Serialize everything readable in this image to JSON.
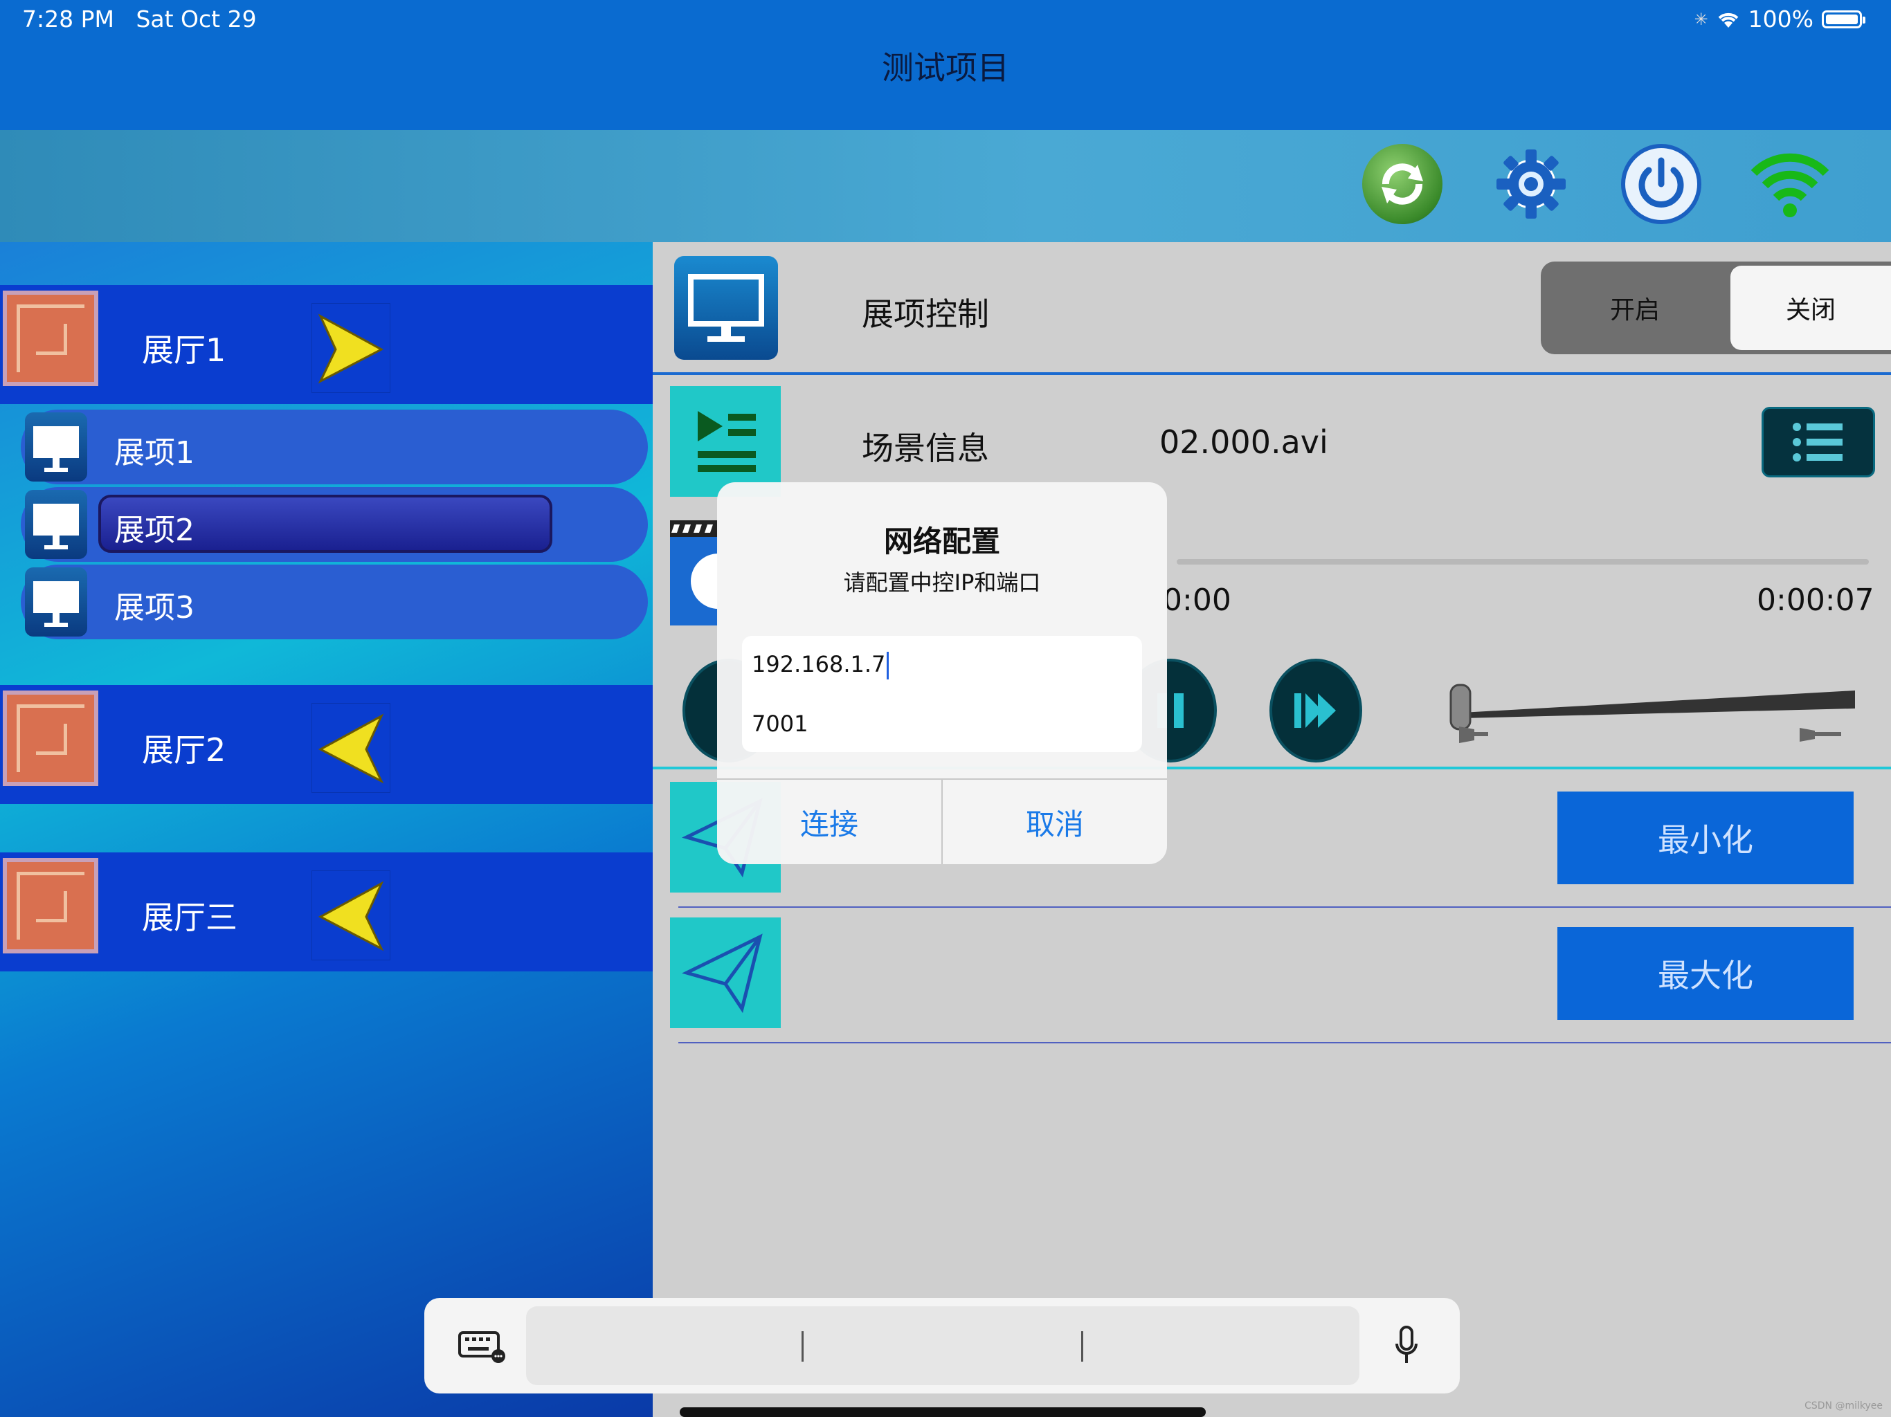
{
  "status_bar": {
    "time": "7:28 PM",
    "date": "Sat Oct 29",
    "battery": "100%"
  },
  "title": "测试项目",
  "toolbar": {
    "icons": [
      "refresh-icon",
      "gear-icon",
      "power-icon",
      "wifi-icon"
    ],
    "colors": {
      "refresh": "#3a8a2a",
      "gear": "#1a60c0",
      "power": "#1a60c0",
      "wifi": "#18b818"
    }
  },
  "sidebar": {
    "halls": [
      {
        "label": "展厅1",
        "arrow": "right",
        "expanded": true,
        "items": [
          {
            "label": "展项1"
          },
          {
            "label": "展项2",
            "selected": true
          },
          {
            "label": "展项3"
          }
        ]
      },
      {
        "label": "展厅2",
        "arrow": "left",
        "expanded": false
      },
      {
        "label": "展厅三",
        "arrow": "left",
        "expanded": false
      }
    ]
  },
  "control": {
    "label": "展项控制",
    "toggle": {
      "on_label": "开启",
      "off_label": "关闭",
      "selected": "关闭"
    }
  },
  "scene": {
    "label": "场景信息",
    "value": "02.000.avi"
  },
  "playback": {
    "current_time": "0:00",
    "total_time": "0:00:07"
  },
  "window_buttons": {
    "minimize": "最小化",
    "maximize": "最大化"
  },
  "dialog": {
    "title": "网络配置",
    "message": "请配置中控IP和端口",
    "ip_value": "192.168.1.7",
    "port_value": "7001",
    "connect_label": "连接",
    "cancel_label": "取消"
  },
  "keyboard_bar": {
    "icons": [
      "keyboard-icon",
      "microphone-icon"
    ]
  },
  "watermark": "CSDN @milkyee"
}
